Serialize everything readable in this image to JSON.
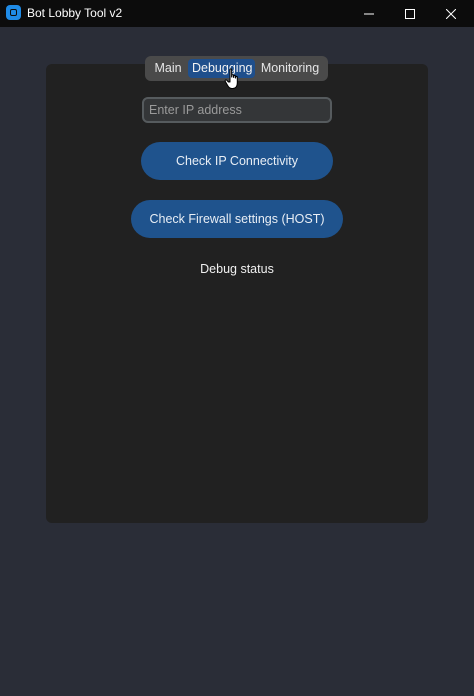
{
  "window": {
    "title": "Bot Lobby Tool v2",
    "icon": "app-icon"
  },
  "titlebar_controls": {
    "minimize": "minimize-icon",
    "maximize": "maximize-icon",
    "close": "close-icon"
  },
  "tabs": [
    {
      "label": "Main",
      "selected": false
    },
    {
      "label": "Debugging",
      "selected": true
    },
    {
      "label": "Monitoring",
      "selected": false
    }
  ],
  "ip_input": {
    "placeholder": "Enter IP address",
    "value": ""
  },
  "buttons": {
    "check_ip": "Check IP Connectivity",
    "check_firewall": "Check Firewall settings (HOST)"
  },
  "status": {
    "text": "Debug status"
  },
  "colors": {
    "accent": "#1f538d",
    "selected_tab": "#1f4f8c",
    "panel": "#212121",
    "background": "#2a2d37",
    "titlebar": "#0c0c0c"
  },
  "cursor": "hand-pointer-icon"
}
